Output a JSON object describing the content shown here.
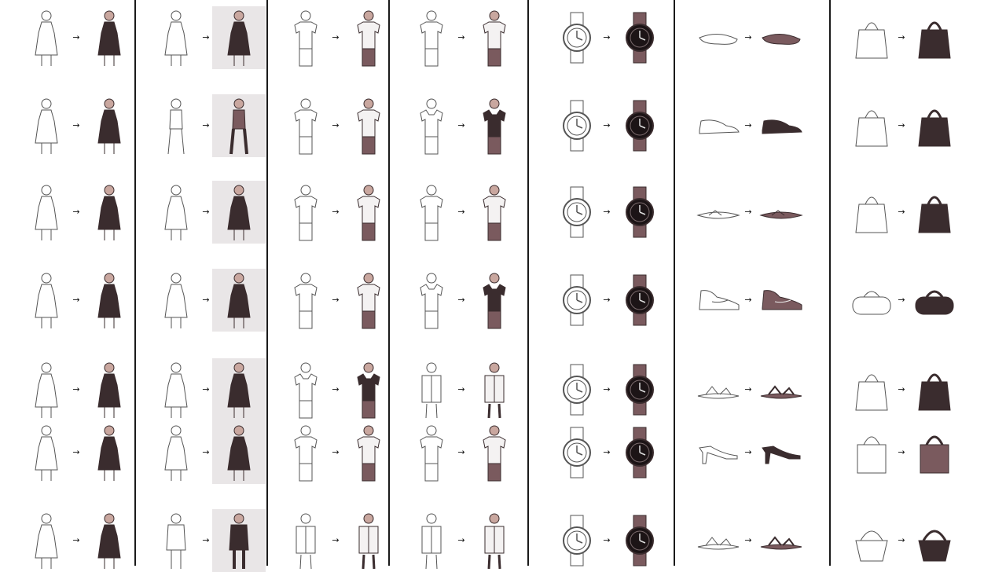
{
  "grid": {
    "arrow_glyph": "→",
    "columns": [
      {
        "name": "dresses",
        "icon": "dress-icon",
        "cells": [
          "dress",
          "dress",
          "dress",
          "dress",
          "dress",
          "dress",
          "dress"
        ]
      },
      {
        "name": "women-outfits",
        "icon": "woman-figure-icon",
        "cells": [
          "dress",
          "woman",
          "dress",
          "dress",
          "dress",
          "dress",
          "jacket"
        ]
      },
      {
        "name": "men-tshirts",
        "icon": "tshirt-icon",
        "cells": [
          "tshirt",
          "tshirt",
          "tshirt",
          "tshirt",
          "polo",
          "tshirt",
          "shirt"
        ]
      },
      {
        "name": "men-shirts",
        "icon": "polo-icon",
        "cells": [
          "tshirt",
          "polo",
          "tshirt",
          "polo",
          "shirt",
          "tshirt",
          "shirt"
        ]
      },
      {
        "name": "watches",
        "icon": "watch-icon",
        "cells": [
          "watch",
          "watch",
          "watch",
          "watch",
          "watch",
          "watch",
          "watch"
        ]
      },
      {
        "name": "shoes",
        "icon": "shoe-icon",
        "cells": [
          "flat",
          "shoe",
          "flipflop",
          "sneaker",
          "sandal",
          "heel",
          "sandal"
        ]
      },
      {
        "name": "handbags",
        "icon": "handbag-icon",
        "cells": [
          "handbag",
          "handbag",
          "handbag",
          "duffel",
          "handbag",
          "tote",
          "clutch"
        ]
      }
    ],
    "backdrop_column": 1,
    "colors": {
      "sketch_line": "#555555",
      "photo_dark": "#3a2c2e",
      "photo_mid": "#7a5a5e",
      "photo_skin": "#c9a79f",
      "divider": "#1a1a1a"
    }
  }
}
